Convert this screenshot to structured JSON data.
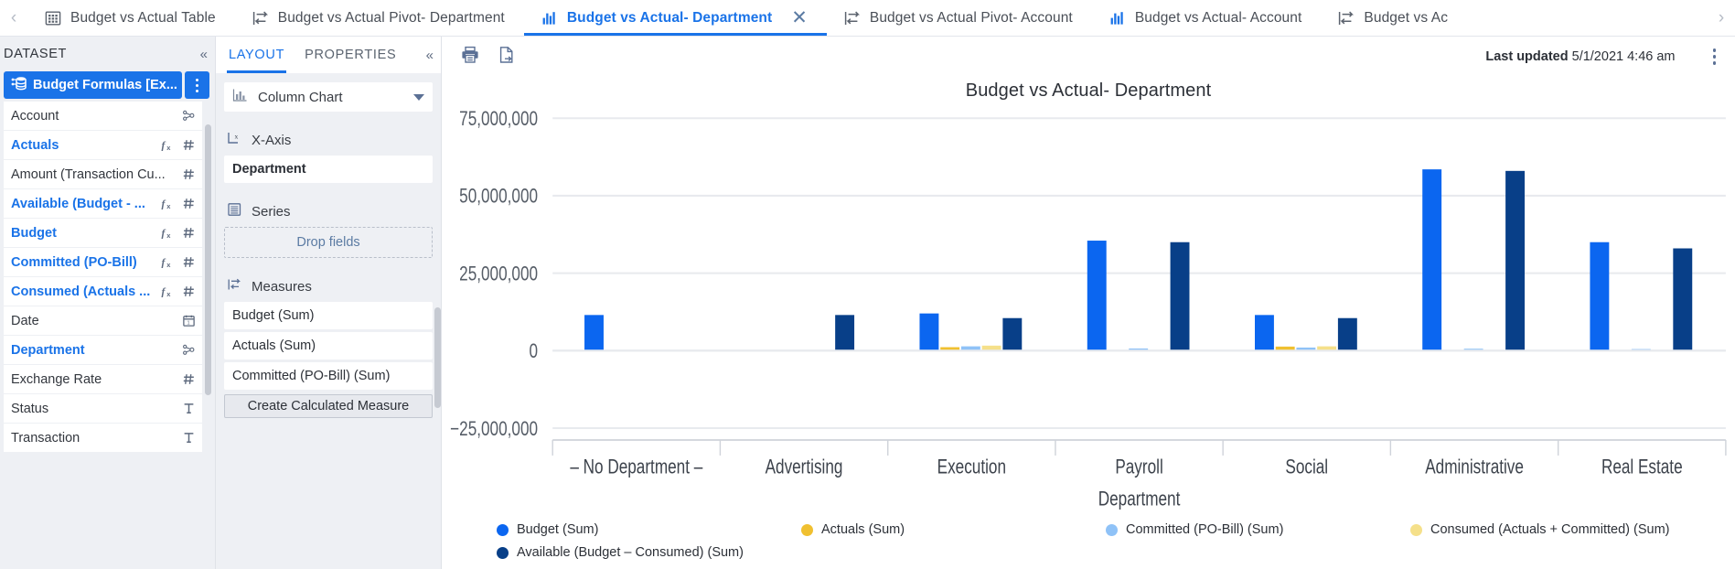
{
  "tabbar": {
    "scroll_left": "‹",
    "scroll_right": "›",
    "tabs": [
      {
        "label": "Budget vs Actual Table",
        "icon": "table-icon",
        "active": false,
        "closable": false
      },
      {
        "label": "Budget vs Actual Pivot- Department",
        "icon": "pivot-icon",
        "active": false,
        "closable": false
      },
      {
        "label": "Budget vs Actual- Department",
        "icon": "bar-chart-icon",
        "active": true,
        "closable": true,
        "close": "✕"
      },
      {
        "label": "Budget vs Actual Pivot- Account",
        "icon": "pivot-icon",
        "active": false,
        "closable": false
      },
      {
        "label": "Budget vs Actual- Account",
        "icon": "bar-chart-icon",
        "active": false,
        "closable": false
      },
      {
        "label": "Budget vs Ac",
        "icon": "pivot-icon",
        "active": false,
        "closable": false
      }
    ]
  },
  "dataset_panel": {
    "title": "DATASET",
    "collapse_label": "«",
    "source": {
      "label": "Budget Formulas [Ex...",
      "icon": "dataset-icon"
    },
    "kebab_label": "more-options",
    "fields": [
      {
        "name": "Account",
        "blue": false,
        "fx": false,
        "type": "hierarchy"
      },
      {
        "name": "Actuals",
        "blue": true,
        "fx": true,
        "type": "number"
      },
      {
        "name": "Amount (Transaction Cu...",
        "blue": false,
        "fx": false,
        "type": "number"
      },
      {
        "name": "Available (Budget - ...",
        "blue": true,
        "fx": true,
        "type": "number"
      },
      {
        "name": "Budget",
        "blue": true,
        "fx": true,
        "type": "number"
      },
      {
        "name": "Committed (PO-Bill)",
        "blue": true,
        "fx": true,
        "type": "number"
      },
      {
        "name": "Consumed (Actuals ...",
        "blue": true,
        "fx": true,
        "type": "number"
      },
      {
        "name": "Date",
        "blue": false,
        "fx": false,
        "type": "date"
      },
      {
        "name": "Department",
        "blue": true,
        "fx": false,
        "type": "hierarchy"
      },
      {
        "name": "Exchange Rate",
        "blue": false,
        "fx": false,
        "type": "number"
      },
      {
        "name": "Status",
        "blue": false,
        "fx": false,
        "type": "text"
      },
      {
        "name": "Transaction",
        "blue": false,
        "fx": false,
        "type": "text"
      }
    ]
  },
  "layout_panel": {
    "tabs": [
      {
        "label": "LAYOUT",
        "active": true
      },
      {
        "label": "PROPERTIES",
        "active": false
      }
    ],
    "collapse_label": "«",
    "chart_type": "Column Chart",
    "xaxis": {
      "heading": "X-Axis",
      "field": "Department"
    },
    "series": {
      "heading": "Series",
      "placeholder": "Drop fields"
    },
    "measures": {
      "heading": "Measures",
      "items": [
        "Budget  (Sum)",
        "Actuals  (Sum)",
        "Committed (PO-Bill)  (Sum)"
      ],
      "create_button": "Create Calculated Measure"
    }
  },
  "chart_toolbar": {
    "print_icon": "print-icon",
    "export_icon": "export-icon",
    "last_updated_label": "Last updated",
    "last_updated_value": "5/1/2021 4:46 am",
    "kebab": "more-options"
  },
  "chart_data": {
    "type": "bar",
    "title": "Budget vs Actual- Department",
    "xlabel": "Department",
    "ylabel": "",
    "categories": [
      "– No Department –",
      "Advertising",
      "Execution",
      "Payroll",
      "Social",
      "Administrative",
      "Real Estate"
    ],
    "ytick_labels": [
      "75,000,000",
      "50,000,000",
      "25,000,000",
      "0",
      "−25,000,000"
    ],
    "ytick_values": [
      75000000,
      50000000,
      25000000,
      0,
      -25000000
    ],
    "ylim": [
      -25000000,
      75000000
    ],
    "grid": true,
    "legend_position": "bottom",
    "series": [
      {
        "name": "Budget (Sum)",
        "color": "#0b66f0",
        "values": [
          11500000,
          0,
          12000000,
          35500000,
          11500000,
          58500000,
          35000000
        ]
      },
      {
        "name": "Actuals (Sum)",
        "color": "#f0c030",
        "values": [
          0,
          0,
          1100000,
          0,
          1300000,
          0,
          0
        ]
      },
      {
        "name": "Committed (PO-Bill) (Sum)",
        "color": "#8fc2f7",
        "values": [
          0,
          0,
          1400000,
          700000,
          1000000,
          600000,
          500000
        ]
      },
      {
        "name": "Consumed (Actuals + Committed) (Sum)",
        "color": "#f5e08a",
        "values": [
          0,
          0,
          1600000,
          0,
          1400000,
          0,
          0
        ]
      },
      {
        "name": "Available (Budget – Consumed) (Sum)",
        "color": "#083f88",
        "values": [
          0,
          11500000,
          10500000,
          35000000,
          10500000,
          58000000,
          33000000
        ]
      }
    ],
    "legend": [
      {
        "name": "Budget (Sum)",
        "color": "#0b66f0"
      },
      {
        "name": "Actuals (Sum)",
        "color": "#f0c030"
      },
      {
        "name": "Committed (PO-Bill) (Sum)",
        "color": "#8fc2f7"
      },
      {
        "name": "Consumed (Actuals + Committed) (Sum)",
        "color": "#f5e08a"
      },
      {
        "name": "Available (Budget – Consumed) (Sum)",
        "color": "#083f88"
      }
    ]
  }
}
